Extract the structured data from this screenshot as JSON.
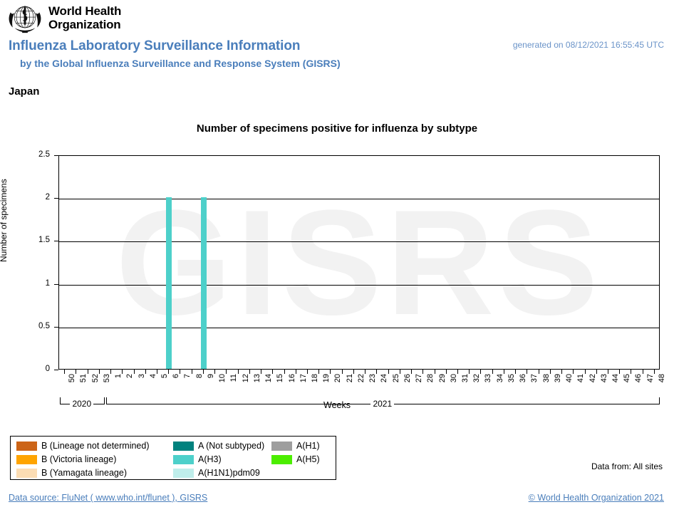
{
  "header": {
    "logo_alt": "who-emblem",
    "organization_line1": "World Health",
    "organization_line2": "Organization",
    "title": "Influenza Laboratory Surveillance Information",
    "subtitle": "by the Global Influenza Surveillance and Response System (GISRS)",
    "generated": "generated on 08/12/2021 16:55:45 UTC",
    "country": "Japan"
  },
  "legend": {
    "items": [
      {
        "label": "B (Lineage not determined)",
        "color": "#CC6417",
        "col": 0,
        "row": 0
      },
      {
        "label": "B (Victoria lineage)",
        "color": "#FFA400",
        "col": 0,
        "row": 1
      },
      {
        "label": "B (Yamagata lineage)",
        "color": "#FCDDB4",
        "col": 0,
        "row": 2
      },
      {
        "label": "A (Not subtyped)",
        "color": "#00827E",
        "col": 1,
        "row": 0
      },
      {
        "label": "A(H3)",
        "color": "#4DD0CA",
        "col": 1,
        "row": 1
      },
      {
        "label": "A(H1N1)pdm09",
        "color": "#BFEEEB",
        "col": 1,
        "row": 2
      },
      {
        "label": "A(H1)",
        "color": "#9E9E9E",
        "col": 2,
        "row": 0
      },
      {
        "label": "A(H5)",
        "color": "#4CEE00",
        "col": 2,
        "row": 1
      }
    ]
  },
  "notes": {
    "data_from": "Data from: All sites"
  },
  "footer": {
    "source": "Data source: FluNet ( www.who.int/flunet ), GISRS",
    "copyright": "© World Health Organization 2021"
  },
  "chart_data": {
    "type": "bar",
    "title": "Number of specimens positive for influenza by subtype",
    "xlabel": "Weeks",
    "ylabel": "Number of specimens",
    "watermark": "GISRS",
    "ylim": [
      0,
      2.5
    ],
    "yticks": [
      0,
      0.5,
      1,
      1.5,
      2,
      2.5
    ],
    "ytick_labels": [
      "0",
      "0.5",
      "1",
      "1.5",
      "2",
      "2.5"
    ],
    "grid": true,
    "stacked": true,
    "legend_position": "below-left",
    "categories": [
      "50",
      "51",
      "52",
      "53",
      "1",
      "2",
      "3",
      "4",
      "5",
      "6",
      "7",
      "8",
      "9",
      "10",
      "11",
      "12",
      "13",
      "14",
      "15",
      "16",
      "17",
      "18",
      "19",
      "20",
      "21",
      "22",
      "23",
      "24",
      "25",
      "26",
      "27",
      "28",
      "29",
      "30",
      "31",
      "32",
      "33",
      "34",
      "35",
      "36",
      "37",
      "38",
      "39",
      "40",
      "41",
      "42",
      "43",
      "44",
      "45",
      "46",
      "47",
      "48"
    ],
    "year_groups": [
      {
        "label": "2020",
        "start_index": 0,
        "end_index": 3
      },
      {
        "label": "2021",
        "start_index": 4,
        "end_index": 51
      }
    ],
    "series": [
      {
        "name": "B (Lineage not determined)",
        "color": "#CC6417",
        "values": [
          0,
          0,
          0,
          0,
          0,
          0,
          0,
          0,
          0,
          0,
          0,
          0,
          0,
          0,
          0,
          0,
          0,
          0,
          0,
          0,
          0,
          0,
          0,
          0,
          0,
          0,
          0,
          0,
          0,
          0,
          0,
          0,
          0,
          0,
          0,
          0,
          0,
          0,
          0,
          0,
          0,
          0,
          0,
          0,
          0,
          0,
          0,
          0,
          0,
          0,
          0,
          0
        ]
      },
      {
        "name": "B (Victoria lineage)",
        "color": "#FFA400",
        "values": [
          0,
          0,
          0,
          0,
          0,
          0,
          0,
          0,
          0,
          0,
          0,
          0,
          0,
          0,
          0,
          0,
          0,
          0,
          0,
          0,
          0,
          0,
          0,
          0,
          0,
          0,
          0,
          0,
          0,
          0,
          0,
          0,
          0,
          0,
          0,
          0,
          0,
          0,
          0,
          0,
          0,
          0,
          0,
          0,
          0,
          0,
          0,
          0,
          0,
          0,
          0,
          0
        ]
      },
      {
        "name": "B (Yamagata lineage)",
        "color": "#FCDDB4",
        "values": [
          0,
          0,
          0,
          0,
          0,
          0,
          0,
          0,
          0,
          0,
          0,
          0,
          0,
          0,
          0,
          0,
          0,
          0,
          0,
          0,
          0,
          0,
          0,
          0,
          0,
          0,
          0,
          0,
          0,
          0,
          0,
          0,
          0,
          0,
          0,
          0,
          0,
          0,
          0,
          0,
          0,
          0,
          0,
          0,
          0,
          0,
          0,
          0,
          0,
          0,
          0,
          0
        ]
      },
      {
        "name": "A (Not subtyped)",
        "color": "#00827E",
        "values": [
          0,
          0,
          0,
          0,
          0,
          0,
          0,
          0,
          0,
          0,
          0,
          0,
          0,
          0,
          0,
          0,
          0,
          0,
          0,
          0,
          0,
          0,
          0,
          0,
          0,
          0,
          0,
          0,
          0,
          0,
          0,
          0,
          0,
          0,
          0,
          0,
          0,
          0,
          0,
          0,
          0,
          0,
          0,
          0,
          0,
          0,
          0,
          0,
          0,
          0,
          0,
          0
        ]
      },
      {
        "name": "A(H3)",
        "color": "#4DD0CA",
        "values": [
          0,
          0,
          0,
          0,
          0,
          0,
          0,
          0,
          0,
          2,
          0,
          0,
          2,
          0,
          0,
          0,
          0,
          0,
          0,
          0,
          0,
          0,
          0,
          0,
          0,
          0,
          0,
          0,
          0,
          0,
          0,
          0,
          0,
          0,
          0,
          0,
          0,
          0,
          0,
          0,
          0,
          0,
          0,
          0,
          0,
          0,
          0,
          0,
          0,
          0,
          0,
          0
        ]
      },
      {
        "name": "A(H1N1)pdm09",
        "color": "#BFEEEB",
        "values": [
          0,
          0,
          0,
          0,
          0,
          0,
          0,
          0,
          0,
          0,
          0,
          0,
          0,
          0,
          0,
          0,
          0,
          0,
          0,
          0,
          0,
          0,
          0,
          0,
          0,
          0,
          0,
          0,
          0,
          0,
          0,
          0,
          0,
          0,
          0,
          0,
          0,
          0,
          0,
          0,
          0,
          0,
          0,
          0,
          0,
          0,
          0,
          0,
          0,
          0,
          0,
          0
        ]
      },
      {
        "name": "A(H1)",
        "color": "#9E9E9E",
        "values": [
          0,
          0,
          0,
          0,
          0,
          0,
          0,
          0,
          0,
          0,
          0,
          0,
          0,
          0,
          0,
          0,
          0,
          0,
          0,
          0,
          0,
          0,
          0,
          0,
          0,
          0,
          0,
          0,
          0,
          0,
          0,
          0,
          0,
          0,
          0,
          0,
          0,
          0,
          0,
          0,
          0,
          0,
          0,
          0,
          0,
          0,
          0,
          0,
          0,
          0,
          0,
          0
        ]
      },
      {
        "name": "A(H5)",
        "color": "#4CEE00",
        "values": [
          0,
          0,
          0,
          0,
          0,
          0,
          0,
          0,
          0,
          0,
          0,
          0,
          0,
          0,
          0,
          0,
          0,
          0,
          0,
          0,
          0,
          0,
          0,
          0,
          0,
          0,
          0,
          0,
          0,
          0,
          0,
          0,
          0,
          0,
          0,
          0,
          0,
          0,
          0,
          0,
          0,
          0,
          0,
          0,
          0,
          0,
          0,
          0,
          0,
          0,
          0,
          0
        ]
      }
    ]
  }
}
